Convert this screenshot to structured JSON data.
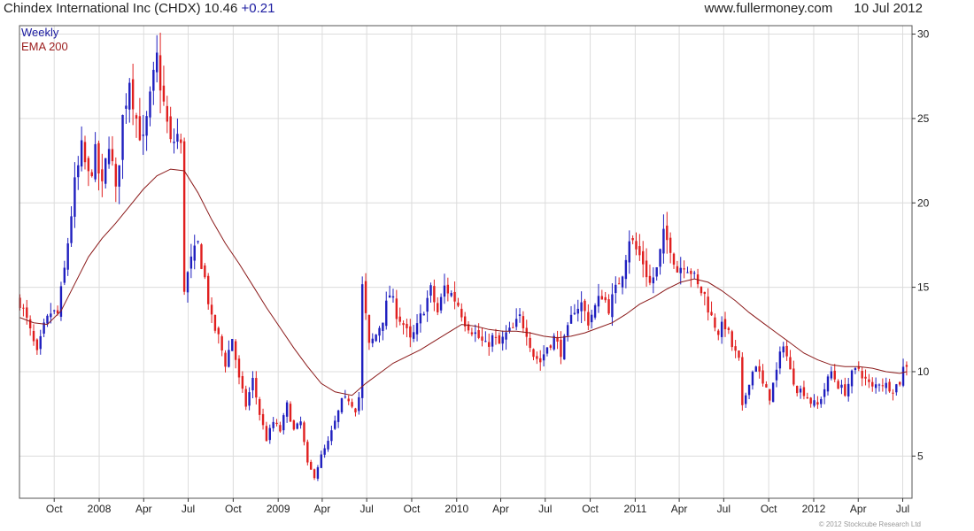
{
  "header": {
    "company": "Chindex International Inc",
    "ticker": "(CHDX)",
    "price": "10.46",
    "change": "+0.21",
    "site": "www.fullermoney.com",
    "date": "10 Jul 2012"
  },
  "footer": {
    "copyright": "© 2012 Stockcube Research Ltd"
  },
  "colors": {
    "up": "#1f1fbf",
    "down": "#e01f1f",
    "ema": "#8b1a1a",
    "grid": "#dcdcdc",
    "axis": "#333333"
  },
  "chart_data": {
    "type": "candlestick",
    "legend": [
      "Weekly",
      "EMA 200"
    ],
    "legend_position": "top-left",
    "grid": true,
    "ylim": [
      2.5,
      30.5
    ],
    "yticks": [
      5,
      10,
      15,
      20,
      25,
      30
    ],
    "xlim": [
      "2007-07-22",
      "2012-07-20"
    ],
    "xticks": [
      {
        "date": "2007-10-01",
        "label": "Oct"
      },
      {
        "date": "2008-01-01",
        "label": "2008"
      },
      {
        "date": "2008-04-01",
        "label": "Apr"
      },
      {
        "date": "2008-07-01",
        "label": "Jul"
      },
      {
        "date": "2008-10-01",
        "label": "Oct"
      },
      {
        "date": "2009-01-01",
        "label": "2009"
      },
      {
        "date": "2009-04-01",
        "label": "Apr"
      },
      {
        "date": "2009-07-01",
        "label": "Jul"
      },
      {
        "date": "2009-10-01",
        "label": "Oct"
      },
      {
        "date": "2010-01-01",
        "label": "2010"
      },
      {
        "date": "2010-04-01",
        "label": "Apr"
      },
      {
        "date": "2010-07-01",
        "label": "Jul"
      },
      {
        "date": "2010-10-01",
        "label": "Oct"
      },
      {
        "date": "2011-01-01",
        "label": "2011"
      },
      {
        "date": "2011-04-01",
        "label": "Apr"
      },
      {
        "date": "2011-07-01",
        "label": "Jul"
      },
      {
        "date": "2011-10-01",
        "label": "Oct"
      },
      {
        "date": "2012-01-01",
        "label": "2012"
      },
      {
        "date": "2012-04-01",
        "label": "Apr"
      },
      {
        "date": "2012-07-01",
        "label": "Jul"
      }
    ],
    "close_path": [
      [
        "2007-07-23",
        14.2
      ],
      [
        "2007-08-06",
        13.0
      ],
      [
        "2007-08-27",
        11.0
      ],
      [
        "2007-09-10",
        12.6
      ],
      [
        "2007-09-24",
        13.5
      ],
      [
        "2007-10-08",
        13.4
      ],
      [
        "2007-10-22",
        16.0
      ],
      [
        "2007-11-05",
        19.4
      ],
      [
        "2007-11-12",
        21.0
      ],
      [
        "2007-11-26",
        23.1
      ],
      [
        "2007-12-10",
        21.5
      ],
      [
        "2007-12-24",
        22.8
      ],
      [
        "2008-01-07",
        20.8
      ],
      [
        "2008-01-21",
        23.8
      ],
      [
        "2008-02-04",
        20.5
      ],
      [
        "2008-02-18",
        25.0
      ],
      [
        "2008-03-03",
        27.5
      ],
      [
        "2008-03-17",
        25.0
      ],
      [
        "2008-03-31",
        23.5
      ],
      [
        "2008-04-14",
        26.0
      ],
      [
        "2008-04-28",
        28.5
      ],
      [
        "2008-05-12",
        25.8
      ],
      [
        "2008-05-26",
        23.4
      ],
      [
        "2008-06-09",
        24.0
      ],
      [
        "2008-06-16",
        23.2
      ],
      [
        "2008-06-23",
        15.0
      ],
      [
        "2008-07-07",
        16.5
      ],
      [
        "2008-07-21",
        17.5
      ],
      [
        "2008-08-04",
        15.5
      ],
      [
        "2008-08-18",
        13.0
      ],
      [
        "2008-09-01",
        12.0
      ],
      [
        "2008-09-15",
        10.5
      ],
      [
        "2008-09-29",
        12.0
      ],
      [
        "2008-10-13",
        9.5
      ],
      [
        "2008-10-27",
        8.0
      ],
      [
        "2008-11-10",
        9.5
      ],
      [
        "2008-11-24",
        7.5
      ],
      [
        "2008-12-08",
        6.0
      ],
      [
        "2008-12-22",
        7.0
      ],
      [
        "2009-01-05",
        6.5
      ],
      [
        "2009-01-19",
        8.0
      ],
      [
        "2009-02-02",
        6.5
      ],
      [
        "2009-02-16",
        7.0
      ],
      [
        "2009-03-02",
        4.5
      ],
      [
        "2009-03-16",
        3.8
      ],
      [
        "2009-03-30",
        5.0
      ],
      [
        "2009-04-13",
        5.8
      ],
      [
        "2009-04-27",
        7.0
      ],
      [
        "2009-05-11",
        8.2
      ],
      [
        "2009-05-25",
        8.4
      ],
      [
        "2009-06-08",
        7.8
      ],
      [
        "2009-06-15",
        8.5
      ],
      [
        "2009-06-22",
        15.0
      ],
      [
        "2009-07-06",
        11.5
      ],
      [
        "2009-07-20",
        12.2
      ],
      [
        "2009-08-03",
        13.2
      ],
      [
        "2009-08-17",
        14.6
      ],
      [
        "2009-08-31",
        13.5
      ],
      [
        "2009-09-14",
        12.8
      ],
      [
        "2009-09-28",
        11.8
      ],
      [
        "2009-10-12",
        12.6
      ],
      [
        "2009-10-26",
        13.8
      ],
      [
        "2009-11-09",
        14.8
      ],
      [
        "2009-11-23",
        13.5
      ],
      [
        "2009-12-07",
        15.0
      ],
      [
        "2009-12-21",
        14.6
      ],
      [
        "2010-01-04",
        14.0
      ],
      [
        "2010-01-18",
        13.0
      ],
      [
        "2010-02-01",
        12.5
      ],
      [
        "2010-02-15",
        12.0
      ],
      [
        "2010-03-01",
        11.5
      ],
      [
        "2010-03-15",
        12.0
      ],
      [
        "2010-03-29",
        11.6
      ],
      [
        "2010-04-12",
        12.2
      ],
      [
        "2010-04-26",
        12.5
      ],
      [
        "2010-05-10",
        13.2
      ],
      [
        "2010-05-24",
        12.4
      ],
      [
        "2010-06-07",
        11.0
      ],
      [
        "2010-06-21",
        10.6
      ],
      [
        "2010-07-05",
        11.5
      ],
      [
        "2010-07-19",
        12.0
      ],
      [
        "2010-08-02",
        11.2
      ],
      [
        "2010-08-16",
        12.4
      ],
      [
        "2010-08-30",
        13.8
      ],
      [
        "2010-09-13",
        14.0
      ],
      [
        "2010-09-27",
        13.0
      ],
      [
        "2010-10-11",
        13.8
      ],
      [
        "2010-10-25",
        14.6
      ],
      [
        "2010-11-08",
        13.8
      ],
      [
        "2010-11-22",
        14.8
      ],
      [
        "2010-12-06",
        16.0
      ],
      [
        "2010-12-20",
        18.0
      ],
      [
        "2011-01-03",
        17.2
      ],
      [
        "2011-01-17",
        16.5
      ],
      [
        "2011-01-31",
        15.2
      ],
      [
        "2011-02-14",
        16.0
      ],
      [
        "2011-02-28",
        18.0
      ],
      [
        "2011-03-14",
        17.5
      ],
      [
        "2011-03-28",
        16.0
      ],
      [
        "2011-04-11",
        16.5
      ],
      [
        "2011-04-25",
        16.0
      ],
      [
        "2011-05-09",
        15.0
      ],
      [
        "2011-05-23",
        14.5
      ],
      [
        "2011-06-06",
        13.2
      ],
      [
        "2011-06-20",
        12.4
      ],
      [
        "2011-07-04",
        12.8
      ],
      [
        "2011-07-18",
        11.5
      ],
      [
        "2011-08-01",
        10.6
      ],
      [
        "2011-08-08",
        7.8
      ],
      [
        "2011-08-22",
        9.5
      ],
      [
        "2011-09-05",
        10.5
      ],
      [
        "2011-09-19",
        9.2
      ],
      [
        "2011-10-03",
        8.5
      ],
      [
        "2011-10-17",
        10.0
      ],
      [
        "2011-10-31",
        11.8
      ],
      [
        "2011-11-14",
        10.0
      ],
      [
        "2011-11-28",
        9.0
      ],
      [
        "2011-12-12",
        8.8
      ],
      [
        "2011-12-26",
        8.2
      ],
      [
        "2012-01-09",
        8.0
      ],
      [
        "2012-01-23",
        9.0
      ],
      [
        "2012-02-06",
        10.0
      ],
      [
        "2012-02-20",
        9.2
      ],
      [
        "2012-03-05",
        8.8
      ],
      [
        "2012-03-19",
        9.8
      ],
      [
        "2012-04-02",
        10.2
      ],
      [
        "2012-04-16",
        9.5
      ],
      [
        "2012-04-30",
        9.0
      ],
      [
        "2012-05-14",
        9.4
      ],
      [
        "2012-05-28",
        9.2
      ],
      [
        "2012-06-11",
        9.0
      ],
      [
        "2012-06-25",
        9.4
      ],
      [
        "2012-07-02",
        10.2
      ],
      [
        "2012-07-09",
        10.46
      ]
    ],
    "ema_path": [
      [
        "2007-07-23",
        13.2
      ],
      [
        "2007-08-20",
        12.9
      ],
      [
        "2007-09-17",
        12.8
      ],
      [
        "2007-10-15",
        13.6
      ],
      [
        "2007-11-12",
        15.2
      ],
      [
        "2007-12-10",
        16.8
      ],
      [
        "2008-01-07",
        17.9
      ],
      [
        "2008-02-04",
        18.8
      ],
      [
        "2008-03-03",
        19.8
      ],
      [
        "2008-03-31",
        20.8
      ],
      [
        "2008-04-28",
        21.6
      ],
      [
        "2008-05-26",
        22.0
      ],
      [
        "2008-06-23",
        21.9
      ],
      [
        "2008-07-21",
        20.6
      ],
      [
        "2008-08-18",
        19.0
      ],
      [
        "2008-09-15",
        17.6
      ],
      [
        "2008-10-13",
        16.4
      ],
      [
        "2008-11-10",
        15.1
      ],
      [
        "2008-12-08",
        13.8
      ],
      [
        "2009-01-05",
        12.6
      ],
      [
        "2009-02-02",
        11.4
      ],
      [
        "2009-03-02",
        10.3
      ],
      [
        "2009-03-30",
        9.3
      ],
      [
        "2009-04-27",
        8.8
      ],
      [
        "2009-06-01",
        8.6
      ],
      [
        "2009-06-29",
        9.3
      ],
      [
        "2009-07-27",
        9.9
      ],
      [
        "2009-08-24",
        10.5
      ],
      [
        "2009-09-21",
        10.9
      ],
      [
        "2009-10-19",
        11.3
      ],
      [
        "2009-11-16",
        11.8
      ],
      [
        "2009-12-14",
        12.3
      ],
      [
        "2010-01-11",
        12.8
      ],
      [
        "2010-02-08",
        12.7
      ],
      [
        "2010-03-08",
        12.5
      ],
      [
        "2010-04-05",
        12.4
      ],
      [
        "2010-05-03",
        12.4
      ],
      [
        "2010-05-31",
        12.3
      ],
      [
        "2010-06-28",
        12.1
      ],
      [
        "2010-07-26",
        12.0
      ],
      [
        "2010-08-23",
        12.1
      ],
      [
        "2010-09-20",
        12.3
      ],
      [
        "2010-10-18",
        12.6
      ],
      [
        "2010-11-15",
        12.9
      ],
      [
        "2010-12-13",
        13.4
      ],
      [
        "2011-01-10",
        14.0
      ],
      [
        "2011-02-07",
        14.4
      ],
      [
        "2011-03-07",
        14.9
      ],
      [
        "2011-04-04",
        15.3
      ],
      [
        "2011-05-02",
        15.5
      ],
      [
        "2011-05-30",
        15.3
      ],
      [
        "2011-06-27",
        14.8
      ],
      [
        "2011-07-25",
        14.2
      ],
      [
        "2011-08-22",
        13.5
      ],
      [
        "2011-09-19",
        12.9
      ],
      [
        "2011-10-17",
        12.3
      ],
      [
        "2011-11-14",
        11.7
      ],
      [
        "2011-12-12",
        11.1
      ],
      [
        "2012-01-09",
        10.7
      ],
      [
        "2012-02-06",
        10.4
      ],
      [
        "2012-03-05",
        10.3
      ],
      [
        "2012-04-02",
        10.3
      ],
      [
        "2012-04-30",
        10.2
      ],
      [
        "2012-05-28",
        10.0
      ],
      [
        "2012-06-25",
        9.9
      ],
      [
        "2012-07-09",
        10.0
      ]
    ]
  }
}
